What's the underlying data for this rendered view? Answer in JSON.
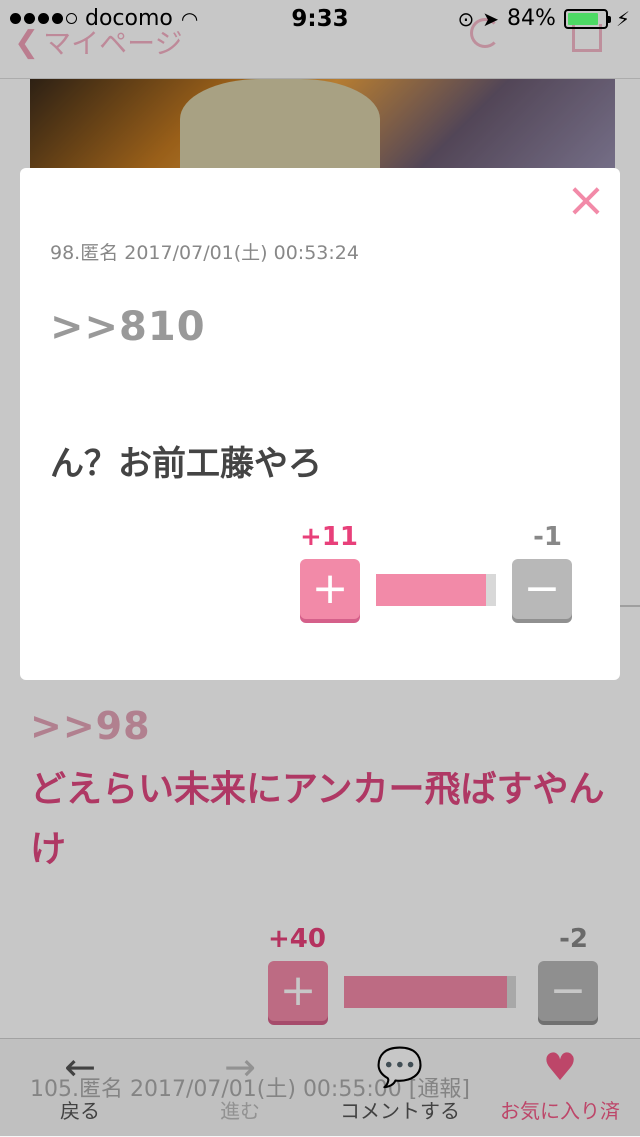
{
  "status_bar": {
    "carrier": "docomo",
    "time": "9:33",
    "battery": "84%",
    "battery_level": 0.84
  },
  "nav": {
    "back_label": "マイページ"
  },
  "modal": {
    "meta": "98.匿名 2017/07/01(土) 00:53:24",
    "anchor": ">>810",
    "body": "ん？お前工藤やろ",
    "vote": {
      "plus": "+11",
      "minus": "-1",
      "ratio": 0.92
    }
  },
  "comment2": {
    "anchor": ">>98",
    "body": "どえらい未来にアンカー飛ばすやんけ",
    "vote": {
      "plus": "+40",
      "minus": "-2",
      "ratio": 0.95
    }
  },
  "peek": {
    "text": "105.匿名 2017/07/01(土) 00:55:00 [通報]"
  },
  "tabbar": {
    "items": [
      {
        "label": "戻る",
        "icon": "arrow-left-icon"
      },
      {
        "label": "進む",
        "icon": "arrow-right-icon"
      },
      {
        "label": "コメントする",
        "icon": "speech-bubble-icon"
      },
      {
        "label": "お気に入り済",
        "icon": "heart-icon"
      }
    ]
  },
  "colors": {
    "accent": "#f25a87",
    "plus": "#f28aa8",
    "minus": "#b8b8b8"
  }
}
